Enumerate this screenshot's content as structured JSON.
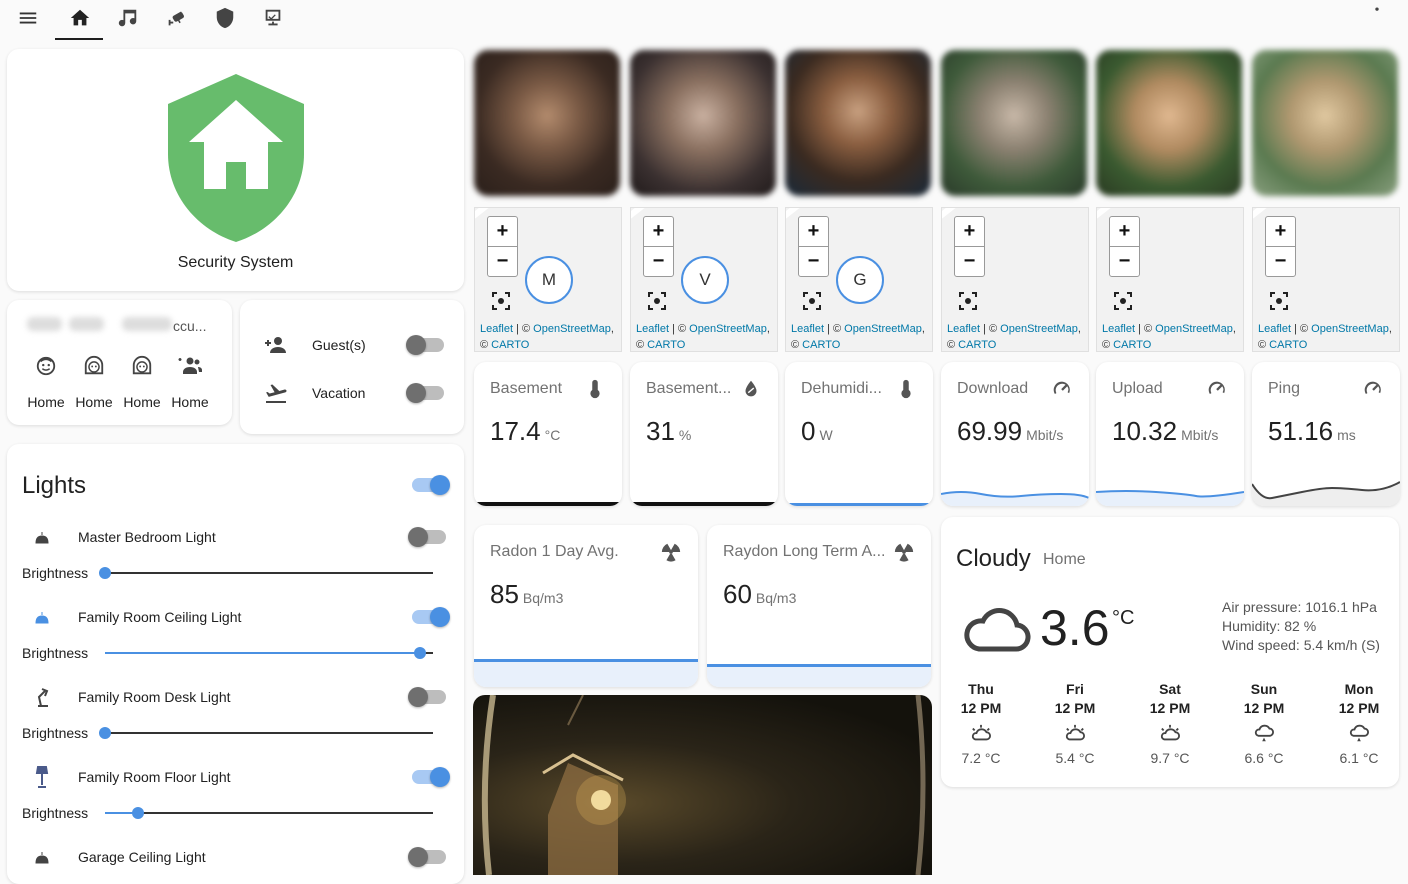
{
  "header": {
    "menu_icon": "menu-icon",
    "tabs": [
      {
        "icon": "home-icon",
        "selected": true
      },
      {
        "icon": "music-icon",
        "selected": false
      },
      {
        "icon": "cctv-icon",
        "selected": false
      },
      {
        "icon": "shield-icon",
        "selected": false
      },
      {
        "icon": "monitor-dashboard-icon",
        "selected": false
      }
    ],
    "overflow_icon": "more-vertical-icon"
  },
  "security": {
    "label": "Security System",
    "color": "#67bc6c"
  },
  "persons": {
    "header_text": "ccu...",
    "people": [
      {
        "icon": "face-boy-icon",
        "state": "Home"
      },
      {
        "icon": "face-woman-icon",
        "state": "Home"
      },
      {
        "icon": "face-woman-icon",
        "state": "Home"
      },
      {
        "icon": "account-group-icon",
        "state": "Home"
      }
    ]
  },
  "modes": [
    {
      "icon": "account-plus-icon",
      "label": "Guest(s)",
      "on": false
    },
    {
      "icon": "airplane-takeoff-icon",
      "label": "Vacation",
      "on": false
    }
  ],
  "lights": {
    "title": "Lights",
    "master_on": true,
    "brightness_label": "Brightness",
    "items": [
      {
        "name": "Master Bedroom Light",
        "icon": "ceiling-light-icon",
        "on": false,
        "brightness": 0
      },
      {
        "name": "Family Room Ceiling Light",
        "icon": "ceiling-light-icon",
        "on": true,
        "brightness": 0.96
      },
      {
        "name": "Family Room Desk Light",
        "icon": "desk-lamp-icon",
        "on": false,
        "brightness": 0
      },
      {
        "name": "Family Room Floor Light",
        "icon": "floor-lamp-icon",
        "on": true,
        "brightness": 0.1
      },
      {
        "name": "Garage Ceiling Light",
        "icon": "ceiling-light-icon",
        "on": false
      }
    ]
  },
  "maps": [
    {
      "avatar": "M"
    },
    {
      "avatar": "V"
    },
    {
      "avatar": "G"
    },
    {
      "avatar": ""
    },
    {
      "avatar": ""
    },
    {
      "avatar": ""
    }
  ],
  "map_attribution": {
    "leaflet": "Leaflet",
    "sep": " | © ",
    "osm": "OpenStreetMap",
    "comma": ",",
    "copy": "© ",
    "carto": "CARTO"
  },
  "sensors": [
    {
      "title": "Basement",
      "value": "17.4",
      "unit": "°C",
      "icon": "thermometer-icon"
    },
    {
      "title": "Basement...",
      "value": "31",
      "unit": "%",
      "icon": "water-percent-icon"
    },
    {
      "title": "Dehumidi...",
      "value": "0",
      "unit": "W",
      "icon": "thermometer-icon"
    },
    {
      "title": "Download",
      "value": "69.99",
      "unit": "Mbit/s",
      "icon": "speedometer-icon"
    },
    {
      "title": "Upload",
      "value": "10.32",
      "unit": "Mbit/s",
      "icon": "speedometer-icon"
    },
    {
      "title": "Ping",
      "value": "51.16",
      "unit": "ms",
      "icon": "speedometer-icon"
    }
  ],
  "radon": [
    {
      "title": "Radon 1 Day Avg.",
      "value": "85",
      "unit": "Bq/m3",
      "icon": "radioactive-icon"
    },
    {
      "title": "Raydon Long Term A...",
      "value": "60",
      "unit": "Bq/m3",
      "icon": "radioactive-icon"
    }
  ],
  "weather": {
    "condition": "Cloudy",
    "location": "Home",
    "icon": "cloud-icon",
    "temperature": "3.6",
    "temp_unit": "°C",
    "air_pressure": "Air pressure: 1016.1 hPa",
    "humidity": "Humidity: 82 %",
    "wind": "Wind speed: 5.4 km/h (S)",
    "forecast": [
      {
        "day": "Thu",
        "time": "12 PM",
        "icon": "partly-cloudy-night-icon",
        "temp": "7.2 °C"
      },
      {
        "day": "Fri",
        "time": "12 PM",
        "icon": "partly-cloudy-night-icon",
        "temp": "5.4 °C"
      },
      {
        "day": "Sat",
        "time": "12 PM",
        "icon": "partly-cloudy-night-icon",
        "temp": "9.7 °C"
      },
      {
        "day": "Sun",
        "time": "12 PM",
        "icon": "rainy-icon",
        "temp": "6.6 °C"
      },
      {
        "day": "Mon",
        "time": "12 PM",
        "icon": "rainy-icon",
        "temp": "6.1 °C"
      }
    ]
  },
  "colors": {
    "accent": "#4a90e2",
    "security_green": "#67bc6c",
    "graph_line": "#4a90e2",
    "ping_line": "#444444"
  }
}
